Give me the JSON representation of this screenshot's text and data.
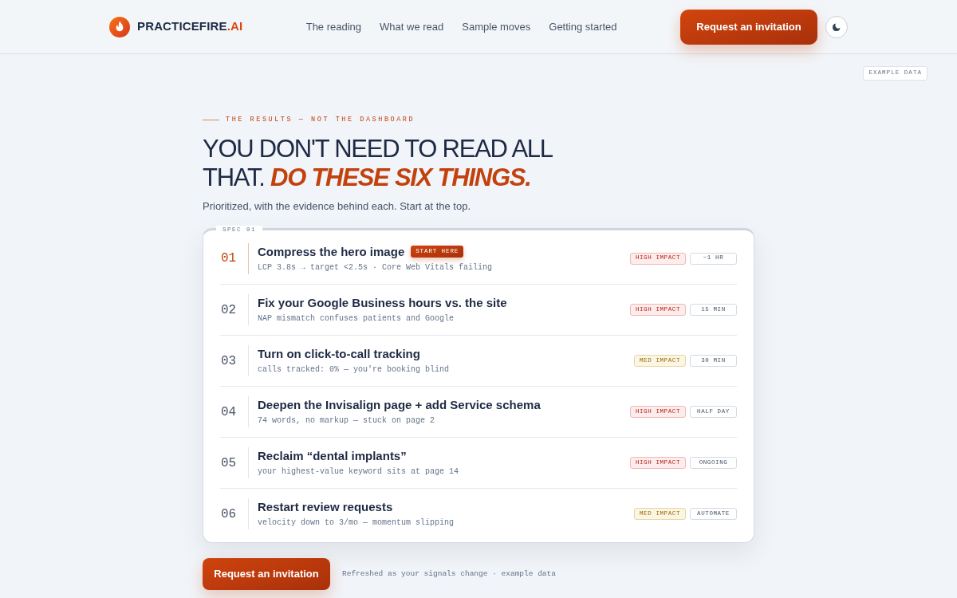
{
  "header": {
    "brand": {
      "name": "PRACTICEFIRE",
      "suffix": ".AI"
    },
    "nav": [
      "The reading",
      "What we read",
      "Sample moves",
      "Getting started"
    ],
    "cta": "Request an invitation"
  },
  "example_badge": "EXAMPLE DATA",
  "hero": {
    "eyebrow": "THE RESULTS — NOT THE DASHBOARD",
    "headline": "YOU DON'T NEED TO READ ALL THAT. **DO THESE SIX THINGS.**",
    "subtitle": "Prioritized, with the evidence behind each. Start at the top."
  },
  "spec": {
    "label": "SPEC 01",
    "items": [
      {
        "number": "01",
        "title": "Compress the hero image",
        "flag": "START HERE",
        "detail": "LCP 3.8s → target <2.5s · Core Web Vitals failing",
        "highlighted": true,
        "impact": {
          "label": "HIGH IMPACT",
          "kind": "high"
        },
        "effort": "~1 HR"
      },
      {
        "number": "02",
        "title": "Fix your Google Business hours vs. the site",
        "detail": "NAP mismatch confuses patients and Google",
        "highlighted": false,
        "impact": {
          "label": "HIGH IMPACT",
          "kind": "high"
        },
        "effort": "15 MIN"
      },
      {
        "number": "03",
        "title": "Turn on click-to-call tracking",
        "detail": "calls tracked: 0% — you're booking blind",
        "highlighted": false,
        "impact": {
          "label": "MED IMPACT",
          "kind": "med"
        },
        "effort": "30 MIN"
      },
      {
        "number": "04",
        "title": "Deepen the Invisalign page + add Service schema",
        "detail": "74 words, no markup — stuck on page 2",
        "highlighted": false,
        "impact": {
          "label": "HIGH IMPACT",
          "kind": "high"
        },
        "effort": "HALF DAY"
      },
      {
        "number": "05",
        "title": "Reclaim “dental implants”",
        "detail": "your highest-value keyword sits at page 14",
        "highlighted": false,
        "impact": {
          "label": "HIGH IMPACT",
          "kind": "high"
        },
        "effort": "ONGOING"
      },
      {
        "number": "06",
        "title": "Restart review requests",
        "detail": "velocity down to 3/mo — momentum slipping",
        "highlighted": false,
        "impact": {
          "label": "MED IMPACT",
          "kind": "med"
        },
        "effort": "AUTOMATE"
      }
    ]
  },
  "footer": {
    "cta": "Request an invitation",
    "note": "Refreshed as your signals change · example data"
  }
}
